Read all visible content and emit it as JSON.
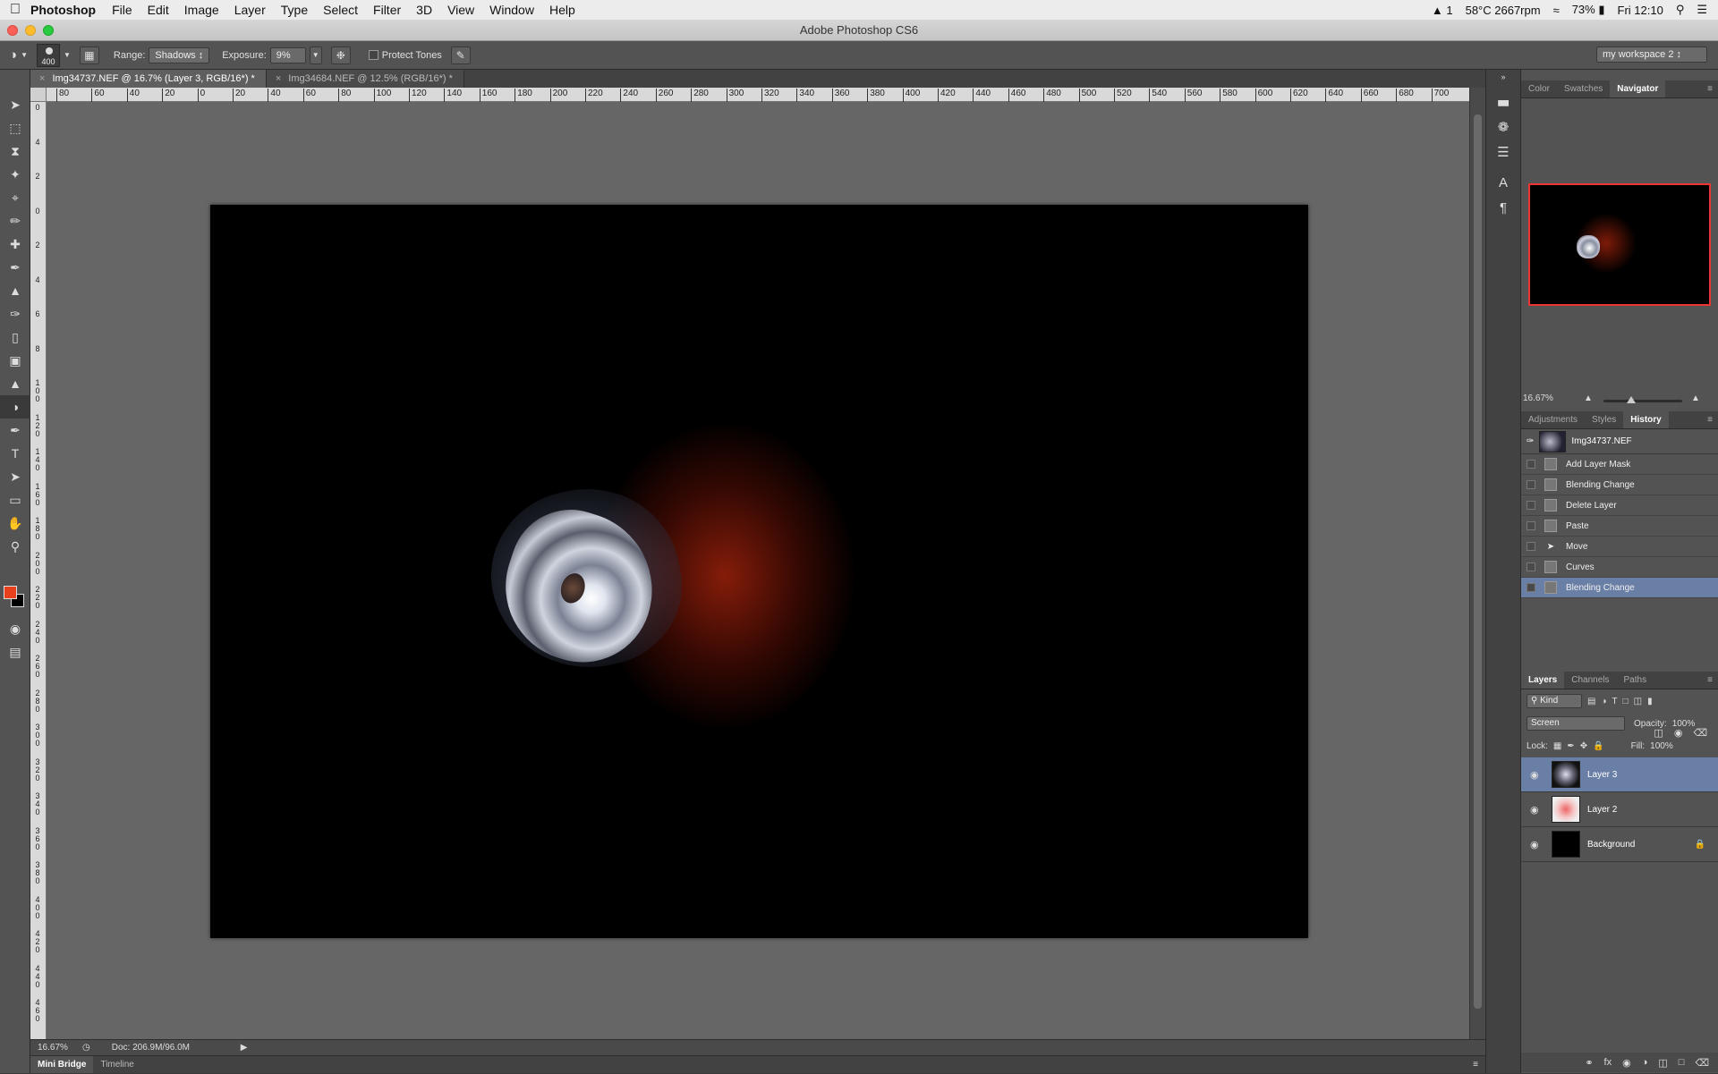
{
  "menubar": {
    "apple": "",
    "app_name": "Photoshop",
    "menus": [
      "File",
      "Edit",
      "Image",
      "Layer",
      "Type",
      "Select",
      "Filter",
      "3D",
      "View",
      "Window",
      "Help"
    ],
    "status": {
      "adobe": "1",
      "temp": "58°C 2667rpm",
      "battery": "73%",
      "clock": "Fri 12:10"
    }
  },
  "window": {
    "title": "Adobe Photoshop CS6"
  },
  "options": {
    "brush_size": "400",
    "range_label": "Range:",
    "range_value": "Shadows",
    "exposure_label": "Exposure:",
    "exposure_value": "9%",
    "protect_tones": "Protect Tones",
    "workspace": "my workspace 2"
  },
  "tabs": [
    {
      "label": "Img34737.NEF @ 16.7% (Layer 3, RGB/16*) *",
      "active": true
    },
    {
      "label": "Img34684.NEF @ 12.5% (RGB/16*) *",
      "active": false
    }
  ],
  "ruler": {
    "top_ticks": [
      "80",
      "60",
      "40",
      "20",
      "0",
      "20",
      "40",
      "60",
      "80",
      "100",
      "120",
      "140",
      "160",
      "180",
      "200",
      "220",
      "240",
      "260",
      "280",
      "300",
      "320",
      "340",
      "360",
      "380",
      "400",
      "420",
      "440",
      "460",
      "480",
      "500",
      "520",
      "540",
      "560",
      "580",
      "600",
      "620",
      "640",
      "660",
      "680",
      "700"
    ],
    "left_ticks": [
      "0",
      "4",
      "2",
      "0",
      "2",
      "4",
      "6",
      "8",
      "1 0 0",
      "1 2 0",
      "1 4 0",
      "1 6 0",
      "1 8 0",
      "2 0 0",
      "2 2 0",
      "2 4 0",
      "2 6 0",
      "2 8 0",
      "3 0 0",
      "3 2 0",
      "3 4 0",
      "3 6 0",
      "3 8 0",
      "4 0 0",
      "4 2 0",
      "4 4 0",
      "4 6 0"
    ]
  },
  "status": {
    "zoom": "16.67%",
    "doc": "Doc: 206.9M/96.0M"
  },
  "bottom_tabs": [
    "Mini Bridge",
    "Timeline"
  ],
  "navigator": {
    "tabs": [
      "Color",
      "Swatches",
      "Navigator"
    ],
    "zoom": "16.67%"
  },
  "history": {
    "tabs": [
      "Adjustments",
      "Styles",
      "History"
    ],
    "snapshot": "Img34737.NEF",
    "items": [
      "Add Layer Mask",
      "Blending Change",
      "Delete Layer",
      "Paste",
      "Move",
      "Curves",
      "Blending Change"
    ]
  },
  "layers": {
    "tabs": [
      "Layers",
      "Channels",
      "Paths"
    ],
    "kind_filter": "Kind",
    "blend_mode": "Screen",
    "opacity_label": "Opacity:",
    "opacity_value": "100%",
    "lock_label": "Lock:",
    "fill_label": "Fill:",
    "fill_value": "100%",
    "items": [
      {
        "name": "Layer 3",
        "selected": true
      },
      {
        "name": "Layer 2",
        "selected": false
      },
      {
        "name": "Background",
        "selected": false
      }
    ]
  },
  "colors": {
    "foreground": "#e8401c",
    "background": "#000000",
    "selection": "#6a7fa6"
  }
}
